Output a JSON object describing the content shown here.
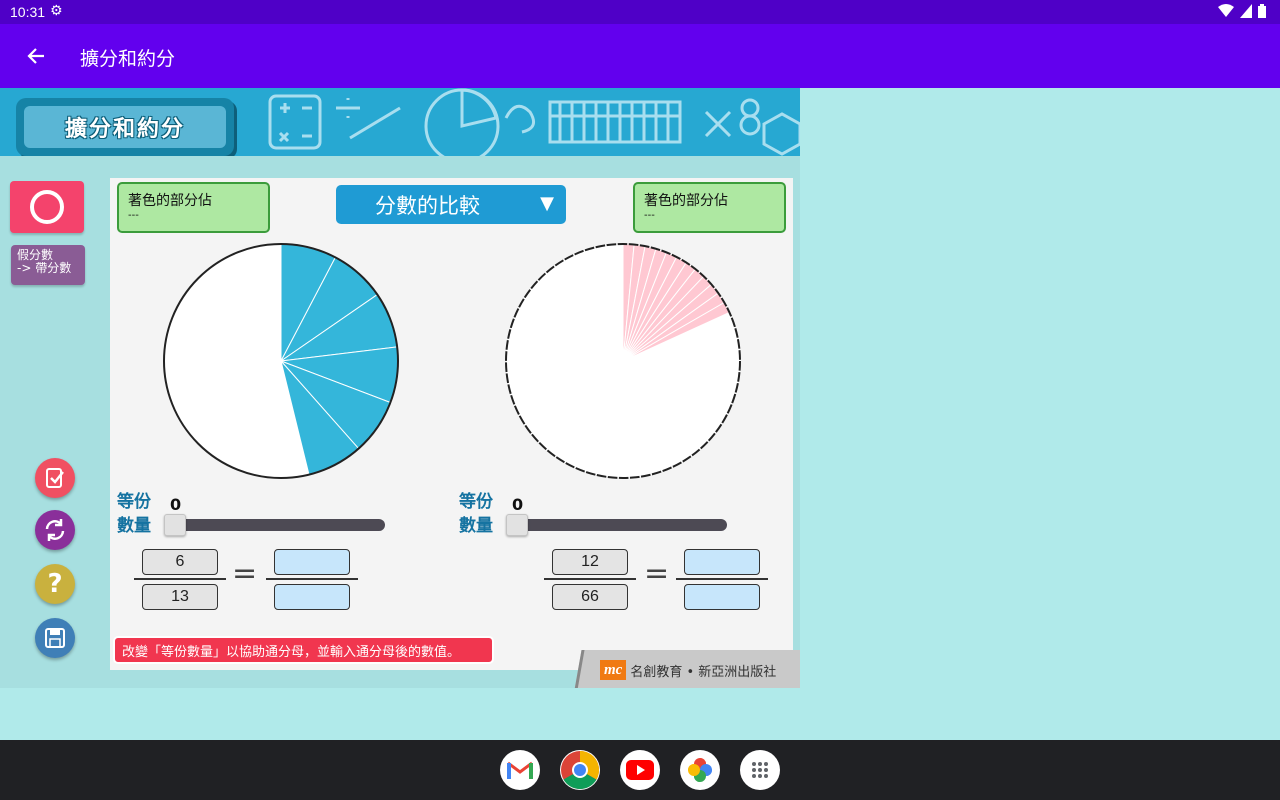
{
  "status_bar": {
    "time": "10:31"
  },
  "app_bar": {
    "title": "擴分和約分"
  },
  "banner": {
    "title": "擴分和約分"
  },
  "sidebar": {
    "convert_label": "假分數\n-> 帶分數"
  },
  "compare": {
    "selected": "分數的比較",
    "left": {
      "estimate_label": "著色的部分佔",
      "estimate_value": "---",
      "pie_shaded_fraction": 0.4615,
      "pie_color": "#34b6da",
      "slider_label": "等份數量",
      "slider_value": "0",
      "numerator": "6",
      "denominator": "13"
    },
    "right": {
      "estimate_label": "著色的部分佔",
      "estimate_value": "---",
      "pie_shaded_fraction": 0.1818,
      "pie_color": "#ffc8d2",
      "slider_label": "等份數量",
      "slider_value": "0",
      "numerator": "12",
      "denominator": "66"
    }
  },
  "hint": "改變「等份數量」以協助通分母，並輸入通分母後的數值。",
  "publisher": {
    "logo": "mc",
    "text": "名創教育 • 新亞洲出版社"
  },
  "dock": [
    "gmail-icon",
    "chrome-icon",
    "youtube-icon",
    "photos-icon",
    "app-drawer-icon"
  ]
}
